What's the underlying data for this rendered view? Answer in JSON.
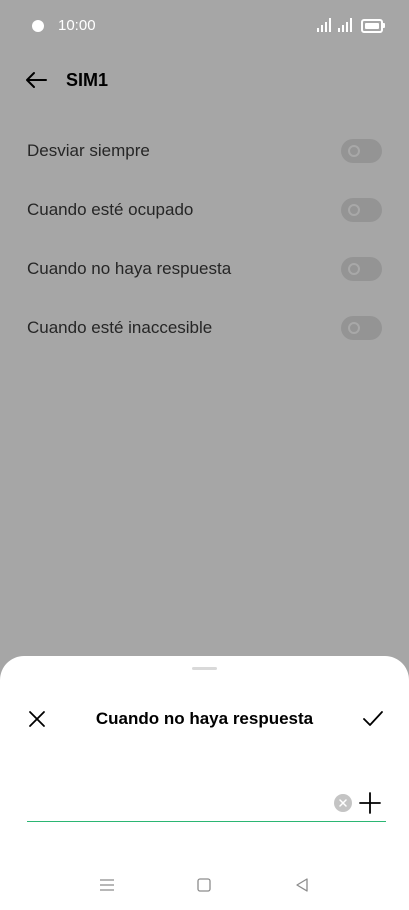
{
  "status_bar": {
    "time": "10:00"
  },
  "header": {
    "title": "SIM1"
  },
  "forwarding_options": [
    {
      "label": "Desviar siempre",
      "enabled": false
    },
    {
      "label": "Cuando esté ocupado",
      "enabled": false
    },
    {
      "label": "Cuando no haya respuesta",
      "enabled": false
    },
    {
      "label": "Cuando esté inaccesible",
      "enabled": false
    }
  ],
  "dialog": {
    "title": "Cuando no haya respuesta",
    "number_value": "",
    "accent_color": "#2bb673"
  },
  "icons": {
    "back": "arrow-left-icon",
    "close": "close-icon",
    "confirm": "checkmark-icon",
    "clear": "clear-icon",
    "add": "plus-icon",
    "nav_menu": "menu-icon",
    "nav_home": "home-square-icon",
    "nav_back": "back-triangle-icon"
  }
}
